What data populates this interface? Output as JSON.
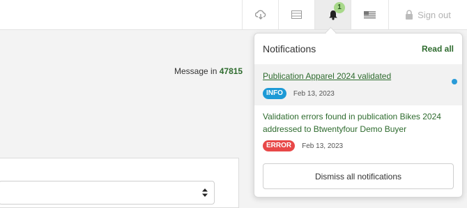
{
  "topbar": {
    "cloud_icon": "cloud-download-icon",
    "list_icon": "list-icon",
    "bell_icon": "bell-icon",
    "notification_count": "1",
    "flag_icon": "us-flag-icon",
    "signout_label": "Sign out",
    "lock_icon": "lock-icon"
  },
  "main": {
    "message_prefix": "Message in",
    "message_number": "47815"
  },
  "notifications": {
    "title": "Notifications",
    "read_all": "Read all",
    "items": [
      {
        "title": "Publication Apparel 2024 validated",
        "badge": "INFO",
        "date": "Feb 13, 2023",
        "unread": true
      },
      {
        "title": "Validation errors found in publication Bikes 2024 addressed to Btwentyfour Demo Buyer",
        "badge": "ERROR",
        "date": "Feb 13, 2023",
        "unread": false
      }
    ],
    "dismiss_label": "Dismiss all notifications"
  },
  "colors": {
    "accent_green": "#2e6b2e",
    "info_blue": "#1d9ad6",
    "error_red": "#e84848",
    "badge_green": "#a8d88a"
  }
}
